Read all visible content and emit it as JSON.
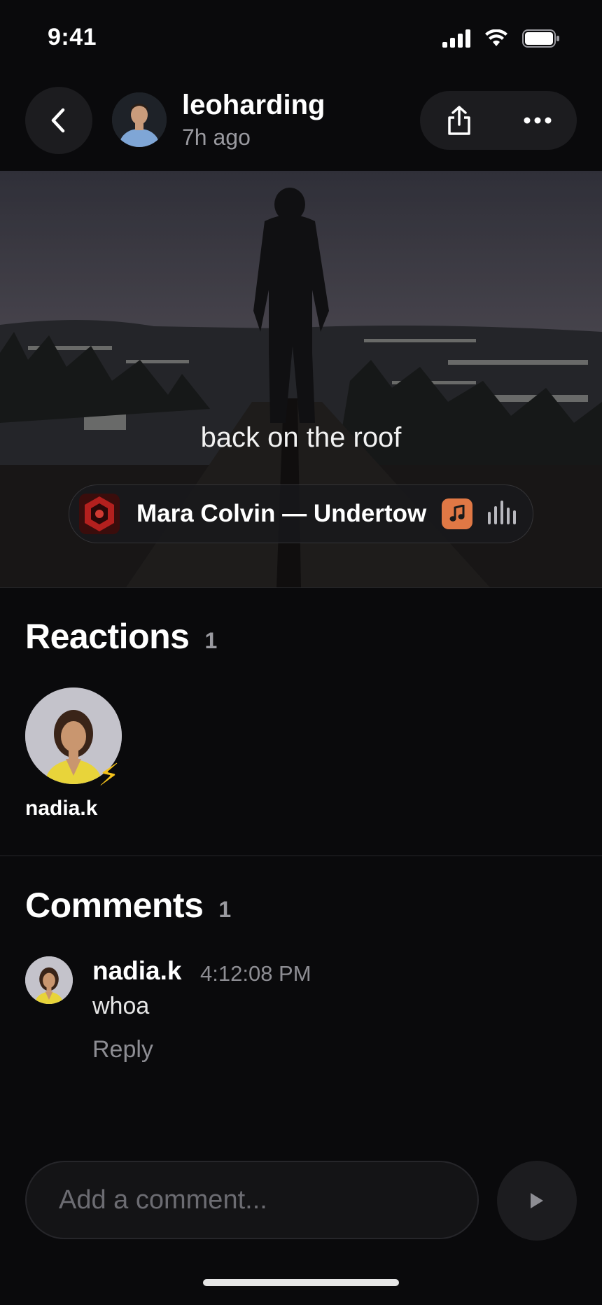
{
  "status_bar": {
    "time": "9:41"
  },
  "header": {
    "username": "leoharding",
    "posted_ago": "7h ago"
  },
  "post": {
    "caption": "back on the roof",
    "music": {
      "track": "Mara Colvin — Undertow",
      "app_icon": "music-note-icon",
      "cover_color": "#b3201e"
    }
  },
  "reactions": {
    "title": "Reactions",
    "count": "1",
    "items": [
      {
        "name": "nadia.k",
        "emoji": "⚡"
      }
    ]
  },
  "comments": {
    "title": "Comments",
    "count": "1",
    "items": [
      {
        "name": "nadia.k",
        "time": "4:12:08 PM",
        "text": "whoa",
        "reply_label": "Reply"
      }
    ]
  },
  "composer": {
    "placeholder": "Add a comment..."
  },
  "colors": {
    "background": "#0a0a0c",
    "accent": "#e07845",
    "surface": "#1c1c1f"
  }
}
